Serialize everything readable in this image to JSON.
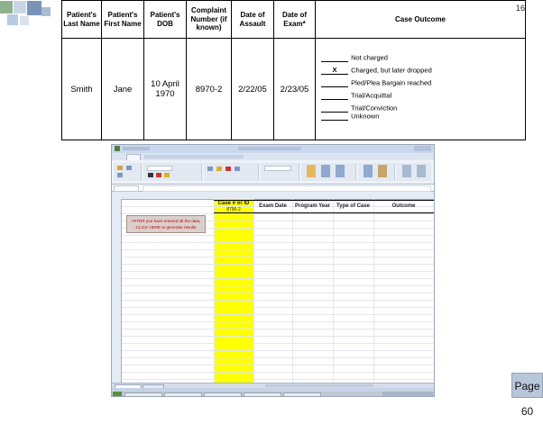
{
  "slide": {
    "number": "16",
    "page_label": "Page 60"
  },
  "summary": {
    "headers": [
      "Patient's Last Name",
      "Patient's First Name",
      "Patient's DOB",
      "Complaint Number (if known)",
      "Date of Assault",
      "Date of Exam*",
      "Case Outcome"
    ],
    "row": {
      "last_name": "Smith",
      "first_name": "Jane",
      "dob": "10 April 1970",
      "complaint": "8970-2",
      "assault": "2/22/05",
      "exam": "2/23/05"
    },
    "outcomes": [
      {
        "mark": "",
        "label": "Not charged"
      },
      {
        "mark": "X",
        "label": "Charged, but later dropped"
      },
      {
        "mark": "",
        "label": "Pled/Plea Bargain reached"
      },
      {
        "mark": "",
        "label": "Trial/Acquittal"
      },
      {
        "mark": "",
        "label": "Trial/Conviction"
      },
      {
        "mark": "",
        "label": "Unknown"
      }
    ]
  },
  "excel": {
    "headers": [
      "Case # or ID",
      "Exam Date",
      "Program Year",
      "Type of Case",
      "Outcome"
    ],
    "case_value": "8790-2",
    "button_text": "AFTER you have entered all the data, CLICK HERE to generate results"
  },
  "colors": {
    "accent": "#ffff00",
    "ribbon": "#eef2f8",
    "page_label_bg": "#b8c6d9"
  }
}
